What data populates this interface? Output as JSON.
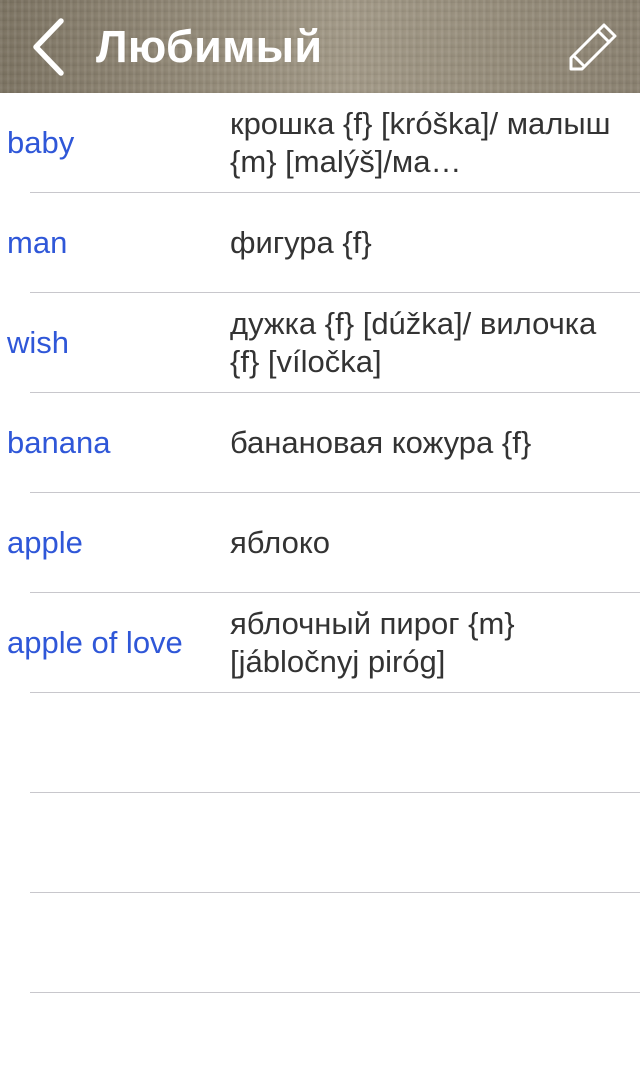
{
  "header": {
    "title": "Любимый",
    "back_icon": "chevron-left-icon",
    "edit_icon": "pencil-icon",
    "text_color": "#ffffff"
  },
  "colors": {
    "term": "#2f57d8",
    "translation": "#333333",
    "separator": "#c8c7cc"
  },
  "favorites": [
    {
      "term": "baby",
      "translation": "крошка {f} [króška]/ малыш {m} [malýš]/ма…"
    },
    {
      "term": "man",
      "translation": "фигура {f}"
    },
    {
      "term": "wish",
      "translation": "дужка {f} [dúžka]/ вилочка {f} [víločka]"
    },
    {
      "term": "banana",
      "translation": "банановая кожура {f}"
    },
    {
      "term": "apple",
      "translation": "яблоко"
    },
    {
      "term": "apple of love",
      "translation": "яблочный пирог {m} [jábločnyj piróg]"
    }
  ]
}
